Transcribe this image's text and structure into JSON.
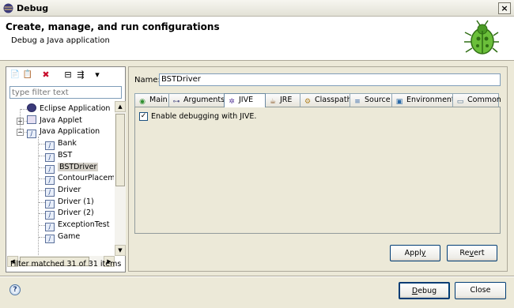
{
  "window": {
    "title": "Debug",
    "close_label": "×"
  },
  "header": {
    "title": "Create, manage, and run configurations",
    "subtitle": "Debug a Java application",
    "icon": "bug-icon"
  },
  "left_toolbar": [
    {
      "name": "new-config-icon",
      "glyph": "📄"
    },
    {
      "name": "duplicate-icon",
      "glyph": "📋"
    },
    {
      "name": "delete-icon",
      "glyph": "✖"
    },
    {
      "name": "collapse-all-icon",
      "glyph": "⊟"
    },
    {
      "name": "filter-icon",
      "glyph": "⇶"
    },
    {
      "name": "view-menu-icon",
      "glyph": "▾"
    }
  ],
  "filter": {
    "placeholder": "type filter text",
    "status": "Filter matched 31 of 31 items"
  },
  "tree": [
    {
      "label": "Eclipse Application",
      "level": 1,
      "expander": "",
      "icon": "eclipse-icon"
    },
    {
      "label": "Java Applet",
      "level": 1,
      "expander": "+",
      "icon": "applet-icon"
    },
    {
      "label": "Java Application",
      "level": 1,
      "expander": "−",
      "icon": "java-app-icon"
    },
    {
      "label": "Bank",
      "level": 2,
      "icon": "java-config-icon"
    },
    {
      "label": "BST",
      "level": 2,
      "icon": "java-config-icon"
    },
    {
      "label": "BSTDriver",
      "level": 2,
      "icon": "java-config-icon",
      "selected": true
    },
    {
      "label": "ContourPlacemen",
      "level": 2,
      "icon": "java-config-icon"
    },
    {
      "label": "Driver",
      "level": 2,
      "icon": "java-config-icon"
    },
    {
      "label": "Driver (1)",
      "level": 2,
      "icon": "java-config-icon"
    },
    {
      "label": "Driver (2)",
      "level": 2,
      "icon": "java-config-icon"
    },
    {
      "label": "ExceptionTest",
      "level": 2,
      "icon": "java-config-icon"
    },
    {
      "label": "Game",
      "level": 2,
      "icon": "java-config-icon"
    }
  ],
  "config": {
    "name_label": "Name:",
    "name_value": "BSTDriver",
    "tabs": [
      {
        "label": "Main",
        "icon": "main-icon",
        "glyph": "◉"
      },
      {
        "label": "Arguments",
        "icon": "arguments-icon",
        "glyph": "⊶"
      },
      {
        "label": "JIVE",
        "icon": "jive-icon",
        "glyph": "✲",
        "active": true
      },
      {
        "label": "JRE",
        "icon": "jre-icon",
        "glyph": "☕"
      },
      {
        "label": "Classpath",
        "icon": "classpath-icon",
        "glyph": "⚙"
      },
      {
        "label": "Source",
        "icon": "source-icon",
        "glyph": "≡"
      },
      {
        "label": "Environment",
        "icon": "environment-icon",
        "glyph": "▣"
      },
      {
        "label": "Common",
        "icon": "common-icon",
        "glyph": "▭"
      }
    ],
    "jive_checkbox_label": "Enable debugging with JIVE.",
    "jive_checked": true,
    "apply_label": "Apply",
    "revert_label": "Revert"
  },
  "footer": {
    "help": "?",
    "debug_label": "Debug",
    "close_label": "Close"
  }
}
